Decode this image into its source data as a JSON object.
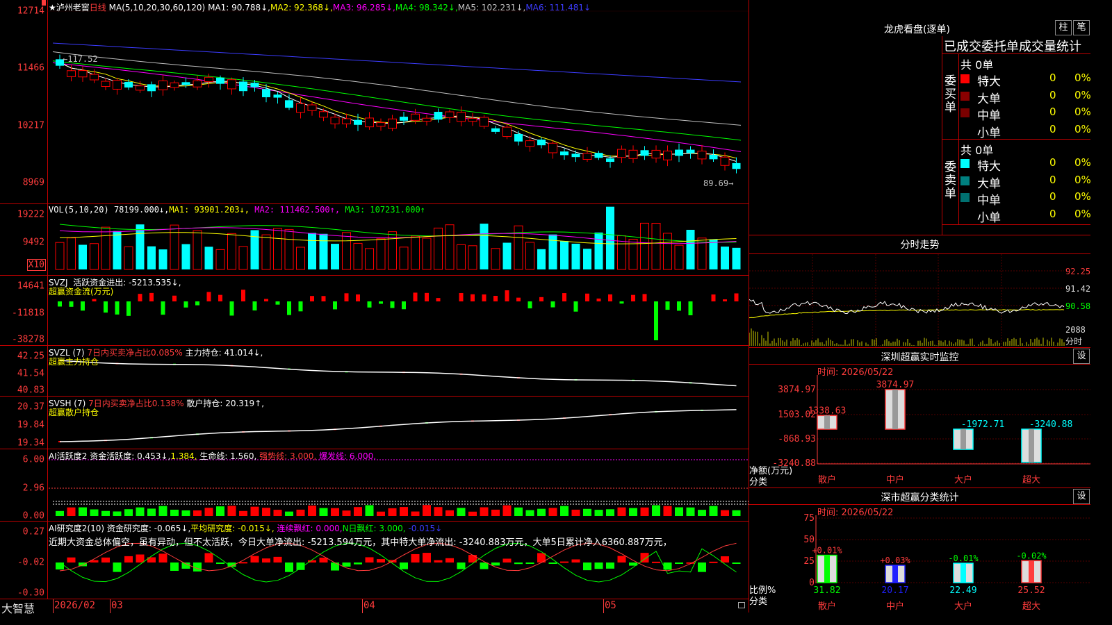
{
  "colors": {
    "up": "#ff0000",
    "down": "#00ffff",
    "ma1": "#ffffff",
    "ma2": "#ffff00",
    "ma3": "#ff00ff",
    "ma4": "#00ff00",
    "ma5": "#c0c0c0",
    "ma6": "#3c3cff"
  },
  "header": {
    "stock_name": "泸州老窖",
    "period": "日线",
    "params": "MA(5,10,20,30,60,120)",
    "ma1": "MA1: 90.788↓,",
    "ma2": "MA2: 92.368↓,",
    "ma3": "MA3: 96.285↓,",
    "ma4": "MA4: 98.342↓,",
    "ma5": "MA5: 102.231↓,",
    "ma6": "MA6: 111.481↓"
  },
  "price_axis": [
    "12714",
    "11466",
    "10217",
    "8969"
  ],
  "price_notes": {
    "high": "117.52",
    "low": "89.69"
  },
  "vol": {
    "title": "VOL(5,10,20)",
    "value": "78199.000↓,",
    "ma1": "MA1: 93901.203↓,",
    "ma2": "MA2: 111462.500↑,",
    "ma3": "MA3: 107231.000↑",
    "axis": [
      "19222",
      "9492"
    ],
    "unit": "X10"
  },
  "svzj": {
    "title": "SVZJ  活跃资金进出: -5213.535↓,",
    "line2": "超赢资金流(万元)",
    "axis": [
      "14641",
      "-11818",
      "-38278"
    ]
  },
  "svzl": {
    "title": "SVZL (7)",
    "t1": "7日内买卖净占比0.085%",
    "t2": "主力持仓: 41.014↓,",
    "line2": "超赢主力持仓",
    "axis": [
      "42.25",
      "41.54",
      "40.83"
    ]
  },
  "svsh": {
    "title": "SVSH (7)",
    "t1": "7日内买卖净占比0.138%",
    "t2": "散户持仓: 20.319↑,",
    "line2": "超赢散户持仓",
    "axis": [
      "20.37",
      "19.84",
      "19.34"
    ]
  },
  "ai1": {
    "title": "AI活跃度2",
    "t1": "资金活跃度: 0.453↓,",
    "t2": "1.384,",
    "t3": "生命线: 1.560,",
    "t4": "强势线: 3.000,",
    "t5": "爆发线: 6.000,",
    "axis": [
      "6.00",
      "2.96",
      "0.00"
    ]
  },
  "ai2": {
    "title": "AI研究度2(10)",
    "t1": "资金研究度: -0.065↓,",
    "t2": "平均研究度: -0.015↓,",
    "t3": "连续飘红: 0.000,",
    "t4": "N日飘红: 3.000,",
    "t5": "-0.015↓",
    "comment": "近期大资金总体偏空，虽有异动，但不太活跃，今日大单净流出: -5213.594万元，其中特大单净流出: -3240.883万元，大单5日累计净入6360.887万元，",
    "axis": [
      "0.27",
      "-0.02",
      "-0.30"
    ]
  },
  "bottom": {
    "brand": "大智慧",
    "dates": [
      "2026/02",
      "03",
      "04",
      "05"
    ]
  },
  "dragon": {
    "title": "龙虎看盘(逐单)",
    "btn1": "柱",
    "btn2": "笔",
    "subtitle": "已成交委托单成交量统计",
    "buy": {
      "label": "委买单",
      "total": "共 0单",
      "rows": [
        {
          "name": "特大",
          "n": "0",
          "p": "0%",
          "c": "#ff0000"
        },
        {
          "name": "大单",
          "n": "0",
          "p": "0%",
          "c": "#8b0000"
        },
        {
          "name": "中单",
          "n": "0",
          "p": "0%",
          "c": "#7a0000"
        },
        {
          "name": "小单",
          "n": "0",
          "p": "0%",
          "c": ""
        }
      ]
    },
    "sell": {
      "label": "委卖单",
      "total": "共 0单",
      "rows": [
        {
          "name": "特大",
          "n": "0",
          "p": "0%",
          "c": "#00ffff"
        },
        {
          "name": "大单",
          "n": "0",
          "p": "0%",
          "c": "#008080"
        },
        {
          "name": "中单",
          "n": "0",
          "p": "0%",
          "c": "#007070"
        },
        {
          "name": "小单",
          "n": "0",
          "p": "0%",
          "c": ""
        }
      ]
    }
  },
  "intraday": {
    "title": "分时走势",
    "axis": [
      "92.25",
      "91.42",
      "90.58"
    ],
    "vol_label": "2088",
    "unit": "分时"
  },
  "monitor": {
    "title": "深圳超赢实时监控",
    "btn": "设",
    "time": "时间: 2026/05/22",
    "axis": [
      "3874.97",
      "1503.02",
      "-868.93",
      "-3240.88"
    ],
    "ylabel": "净额(万元)",
    "xlabel": "分类",
    "chart_data": {
      "type": "bar",
      "categories": [
        "散户",
        "中户",
        "大户",
        "超大"
      ],
      "values": [
        1338.63,
        3874.97,
        -1972.71,
        -3240.88
      ],
      "labels": [
        "1338.63",
        "3874.97",
        "-1972.71",
        "-3240.88"
      ]
    }
  },
  "classify": {
    "title": "深市超赢分类统计",
    "btn": "设",
    "time": "时间: 2026/05/22",
    "axis": [
      "75",
      "50",
      "25",
      "0"
    ],
    "ylabel": "比例%",
    "xlabel": "分类",
    "chart_data": {
      "type": "bar",
      "categories": [
        "散户",
        "中户",
        "大户",
        "超大"
      ],
      "values": [
        31.82,
        20.17,
        22.49,
        25.52
      ],
      "changes": [
        "+0.01%",
        "+0.03%",
        "-0.01%",
        "-0.02%"
      ]
    }
  }
}
